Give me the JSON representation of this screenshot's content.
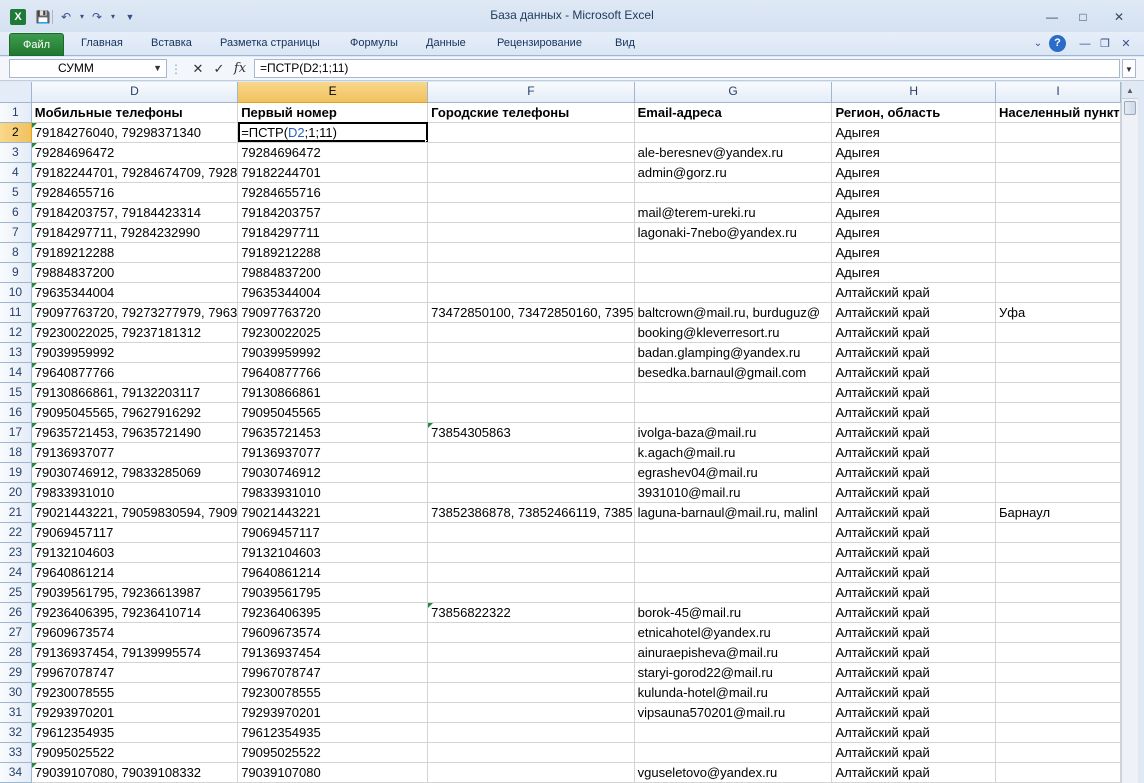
{
  "window": {
    "title": "База данных  -  Microsoft Excel",
    "app_icon": "X"
  },
  "ribbon": {
    "file_tab": "Файл",
    "tabs": [
      "Главная",
      "Вставка",
      "Разметка страницы",
      "Формулы",
      "Данные",
      "Рецензирование",
      "Вид"
    ]
  },
  "formula_bar": {
    "name_box": "СУММ",
    "formula": "=ПСТР(D2;1;11)"
  },
  "columns": [
    "D",
    "E",
    "F",
    "G",
    "H",
    "I"
  ],
  "active_column": "E",
  "active_row": "2",
  "rows": [
    {
      "n": "1",
      "cells": [
        "Мобильные телефоны",
        "Первый номер",
        "Городские телефоны",
        "Email-адреса",
        "Регион, область",
        "Населенный пункт"
      ]
    },
    {
      "n": "2",
      "cells": [
        "79184276040, 79298371340",
        "",
        "",
        "",
        "Адыгея",
        ""
      ]
    },
    {
      "n": "3",
      "cells": [
        "79284696472",
        "79284696472",
        "",
        "ale-beresnev@yandex.ru",
        "Адыгея",
        ""
      ]
    },
    {
      "n": "4",
      "cells": [
        "79182244701, 79284674709, 7928",
        "79182244701",
        "",
        "admin@gorz.ru",
        "Адыгея",
        ""
      ]
    },
    {
      "n": "5",
      "cells": [
        "79284655716",
        "79284655716",
        "",
        "",
        "Адыгея",
        ""
      ]
    },
    {
      "n": "6",
      "cells": [
        "79184203757, 79184423314",
        "79184203757",
        "",
        "mail@terem-ureki.ru",
        "Адыгея",
        ""
      ]
    },
    {
      "n": "7",
      "cells": [
        "79184297711, 79284232990",
        "79184297711",
        "",
        "lagonaki-7nebo@yandex.ru",
        "Адыгея",
        ""
      ]
    },
    {
      "n": "8",
      "cells": [
        "79189212288",
        "79189212288",
        "",
        "",
        "Адыгея",
        ""
      ]
    },
    {
      "n": "9",
      "cells": [
        "79884837200",
        "79884837200",
        "",
        "",
        "Адыгея",
        ""
      ]
    },
    {
      "n": "10",
      "cells": [
        "79635344004",
        "79635344004",
        "",
        "",
        "Алтайский край",
        ""
      ]
    },
    {
      "n": "11",
      "cells": [
        "79097763720, 79273277979, 7963",
        "79097763720",
        "73472850100, 73472850160, 7395",
        "baltcrown@mail.ru, burduguz@",
        "Алтайский край",
        "Уфа"
      ]
    },
    {
      "n": "12",
      "cells": [
        "79230022025, 79237181312",
        "79230022025",
        "",
        "booking@kleverresort.ru",
        "Алтайский край",
        ""
      ]
    },
    {
      "n": "13",
      "cells": [
        "79039959992",
        "79039959992",
        "",
        "badan.glamping@yandex.ru",
        "Алтайский край",
        ""
      ]
    },
    {
      "n": "14",
      "cells": [
        "79640877766",
        "79640877766",
        "",
        "besedka.barnaul@gmail.com",
        "Алтайский край",
        ""
      ]
    },
    {
      "n": "15",
      "cells": [
        "79130866861, 79132203117",
        "79130866861",
        "",
        "",
        "Алтайский край",
        ""
      ]
    },
    {
      "n": "16",
      "cells": [
        "79095045565, 79627916292",
        "79095045565",
        "",
        "",
        "Алтайский край",
        ""
      ]
    },
    {
      "n": "17",
      "cells": [
        "79635721453, 79635721490",
        "79635721453",
        "73854305863",
        "ivolga-baza@mail.ru",
        "Алтайский край",
        ""
      ]
    },
    {
      "n": "18",
      "cells": [
        "79136937077",
        "79136937077",
        "",
        "k.agach@mail.ru",
        "Алтайский край",
        ""
      ]
    },
    {
      "n": "19",
      "cells": [
        "79030746912, 79833285069",
        "79030746912",
        "",
        "egrashev04@mail.ru",
        "Алтайский край",
        ""
      ]
    },
    {
      "n": "20",
      "cells": [
        "79833931010",
        "79833931010",
        "",
        "3931010@mail.ru",
        "Алтайский край",
        ""
      ]
    },
    {
      "n": "21",
      "cells": [
        "79021443221, 79059830594, 7909",
        "79021443221",
        "73852386878, 73852466119, 7385",
        "laguna-barnaul@mail.ru, malinl",
        "Алтайский край",
        "Барнаул"
      ]
    },
    {
      "n": "22",
      "cells": [
        "79069457117",
        "79069457117",
        "",
        "",
        "Алтайский край",
        ""
      ]
    },
    {
      "n": "23",
      "cells": [
        "79132104603",
        "79132104603",
        "",
        "",
        "Алтайский край",
        ""
      ]
    },
    {
      "n": "24",
      "cells": [
        "79640861214",
        "79640861214",
        "",
        "",
        "Алтайский край",
        ""
      ]
    },
    {
      "n": "25",
      "cells": [
        "79039561795, 79236613987",
        "79039561795",
        "",
        "",
        "Алтайский край",
        ""
      ]
    },
    {
      "n": "26",
      "cells": [
        "79236406395, 79236410714",
        "79236406395",
        "73856822322",
        "borok-45@mail.ru",
        "Алтайский край",
        ""
      ]
    },
    {
      "n": "27",
      "cells": [
        "79609673574",
        "79609673574",
        "",
        "etnicahotel@yandex.ru",
        "Алтайский край",
        ""
      ]
    },
    {
      "n": "28",
      "cells": [
        "79136937454, 79139995574",
        "79136937454",
        "",
        "ainuraepisheva@mail.ru",
        "Алтайский край",
        ""
      ]
    },
    {
      "n": "29",
      "cells": [
        "79967078747",
        "79967078747",
        "",
        "staryi-gorod22@mail.ru",
        "Алтайский край",
        ""
      ]
    },
    {
      "n": "30",
      "cells": [
        "79230078555",
        "79230078555",
        "",
        "kulunda-hotel@mail.ru",
        "Алтайский край",
        ""
      ]
    },
    {
      "n": "31",
      "cells": [
        "79293970201",
        "79293970201",
        "",
        "vipsauna570201@mail.ru",
        "Алтайский край",
        ""
      ]
    },
    {
      "n": "32",
      "cells": [
        "79612354935",
        "79612354935",
        "",
        "",
        "Алтайский край",
        ""
      ]
    },
    {
      "n": "33",
      "cells": [
        "79095025522",
        "79095025522",
        "",
        "",
        "Алтайский край",
        ""
      ]
    },
    {
      "n": "34",
      "cells": [
        "79039107080, 79039108332",
        "79039107080",
        "",
        "vguseletovo@yandex.ru",
        "Алтайский край",
        ""
      ]
    }
  ],
  "edit_cell": {
    "row": "2",
    "col": "E",
    "prefix": "=ПСТР(",
    "ref": "D2",
    "suffix": ";1;11)"
  },
  "green_triangle_cells": [
    "2-D",
    "3-D",
    "4-D",
    "5-D",
    "6-D",
    "7-D",
    "8-D",
    "9-D",
    "10-D",
    "11-D",
    "12-D",
    "13-D",
    "14-D",
    "15-D",
    "16-D",
    "17-D",
    "18-D",
    "19-D",
    "20-D",
    "21-D",
    "22-D",
    "23-D",
    "24-D",
    "25-D",
    "26-D",
    "27-D",
    "28-D",
    "29-D",
    "30-D",
    "31-D",
    "32-D",
    "33-D",
    "34-D",
    "17-F",
    "26-F"
  ]
}
